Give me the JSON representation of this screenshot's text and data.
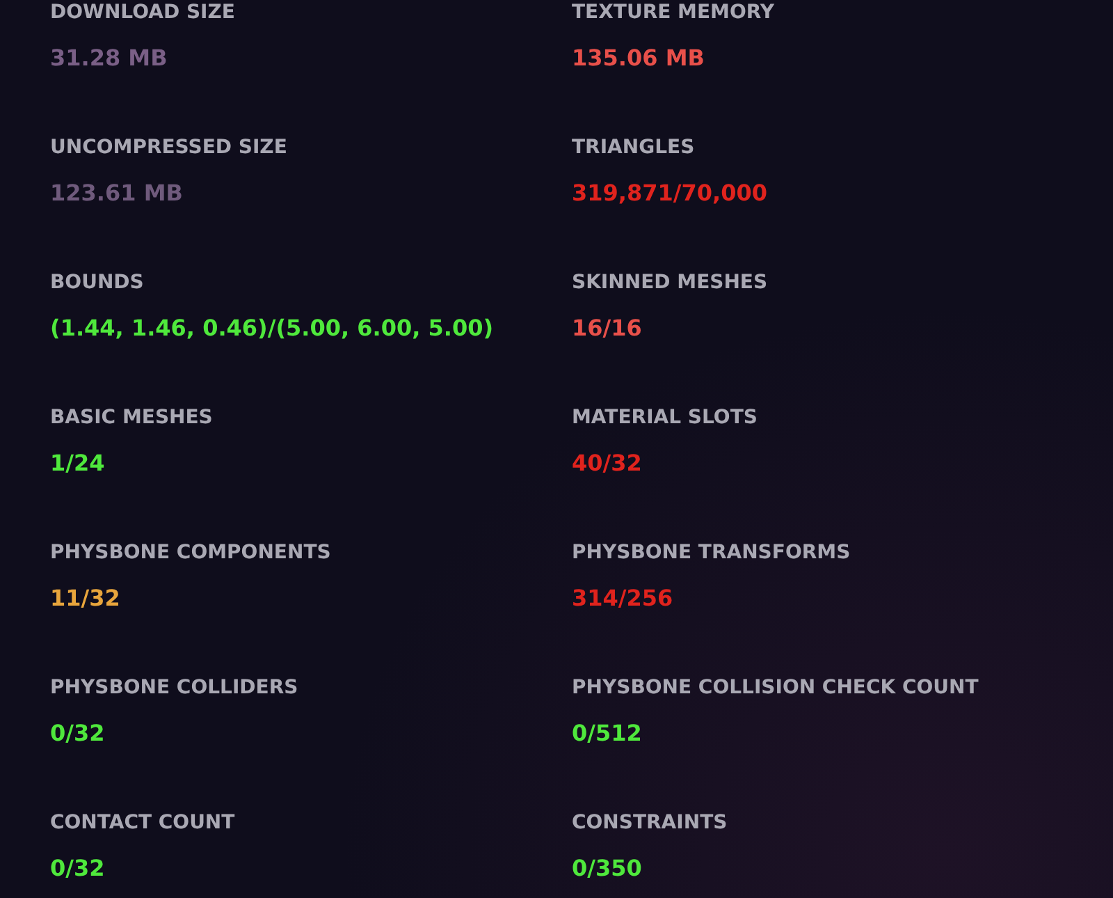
{
  "stats": [
    {
      "label": "DOWNLOAD SIZE",
      "value": "31.28 MB",
      "color": "#7a5f86"
    },
    {
      "label": "TEXTURE MEMORY",
      "value": "135.06 MB",
      "color": "#e8504a"
    },
    {
      "label": "UNCOMPRESSED SIZE",
      "value": "123.61 MB",
      "color": "#6f5a7c"
    },
    {
      "label": "TRIANGLES",
      "value": "319,871/70,000",
      "color": "#e0231d"
    },
    {
      "label": "BOUNDS",
      "value": "(1.44, 1.46, 0.46)/(5.00, 6.00, 5.00)",
      "color": "#4fe83c"
    },
    {
      "label": "SKINNED MESHES",
      "value": "16/16",
      "color": "#e8504a"
    },
    {
      "label": "BASIC MESHES",
      "value": "1/24",
      "color": "#4fe83c"
    },
    {
      "label": "MATERIAL SLOTS",
      "value": "40/32",
      "color": "#e0231d"
    },
    {
      "label": "PHYSBONE COMPONENTS",
      "value": "11/32",
      "color": "#e8a53c"
    },
    {
      "label": "PHYSBONE TRANSFORMS",
      "value": "314/256",
      "color": "#e0231d"
    },
    {
      "label": "PHYSBONE COLLIDERS",
      "value": "0/32",
      "color": "#4fe83c"
    },
    {
      "label": "PHYSBONE COLLISION CHECK COUNT",
      "value": "0/512",
      "color": "#4fe83c"
    },
    {
      "label": "CONTACT COUNT",
      "value": "0/32",
      "color": "#4fe83c"
    },
    {
      "label": "CONSTRAINTS",
      "value": "0/350",
      "color": "#4fe83c"
    }
  ]
}
